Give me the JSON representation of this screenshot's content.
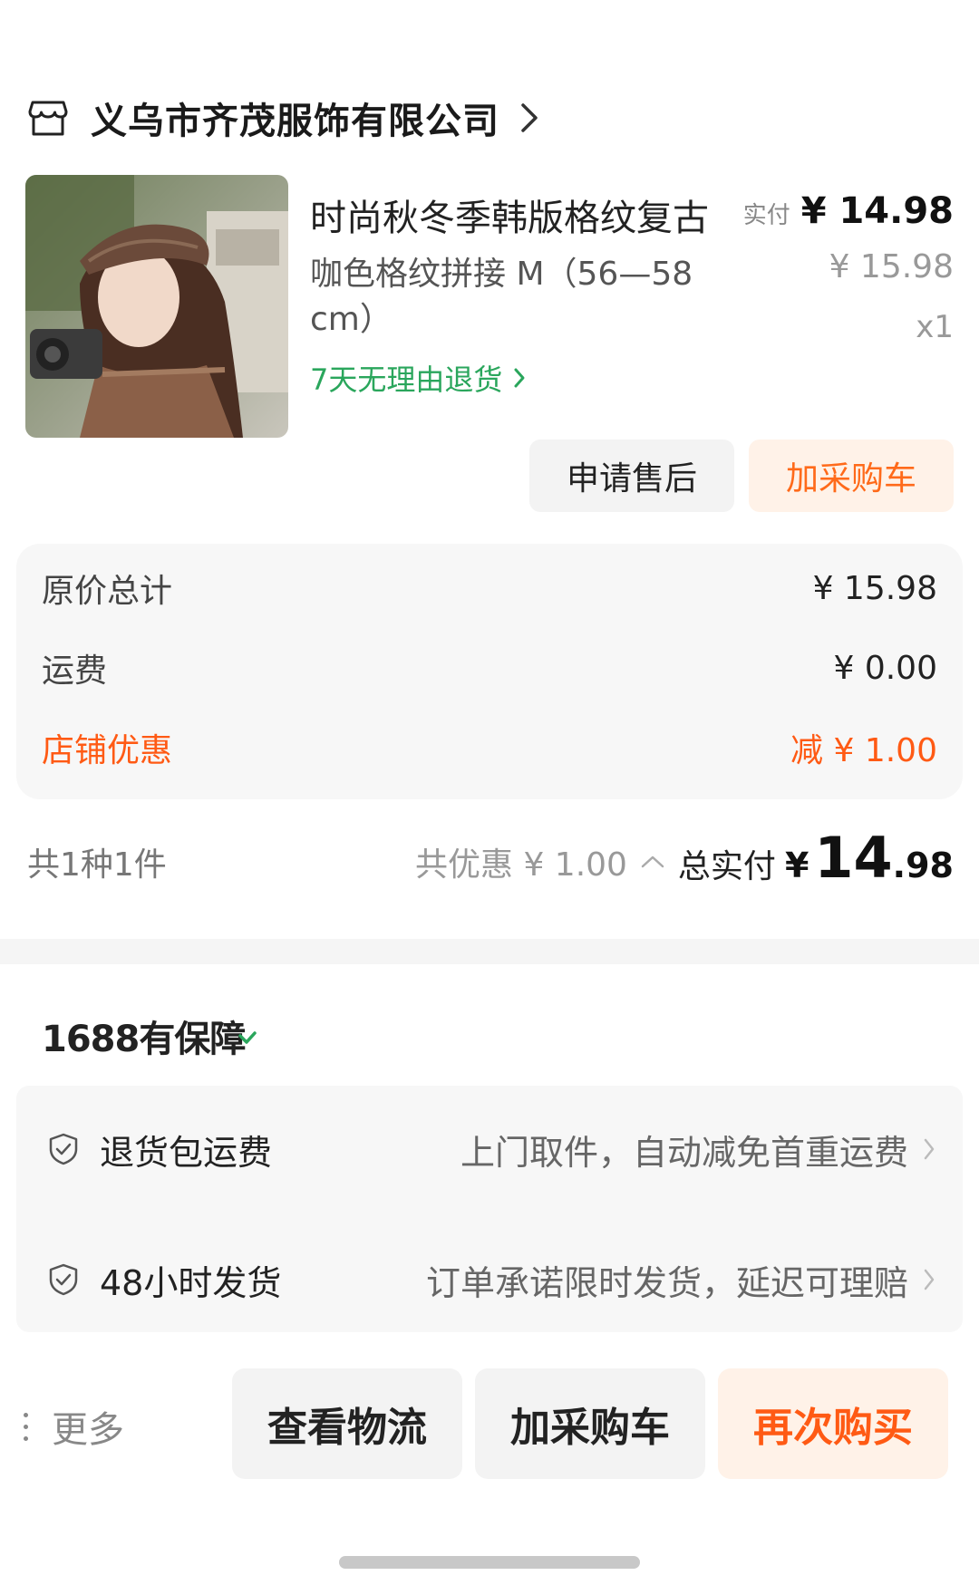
{
  "store": {
    "name": "义乌市齐茂服饰有限公司",
    "icon": "store-icon"
  },
  "product": {
    "title": "时尚秋冬季韩版格纹复古",
    "spec": "咖色格纹拼接 M（56—58 cm）",
    "return_policy": "7天无理由退货",
    "paid_label": "实付",
    "paid_price": "¥ 14.98",
    "original_price": "¥ 15.98",
    "quantity": "x1"
  },
  "actions": {
    "after_sale": "申请售后",
    "add_cart": "加采购车"
  },
  "summary": {
    "original_total_label": "原价总计",
    "original_total_value": "¥ 15.98",
    "shipping_label": "运费",
    "shipping_value": "¥ 0.00",
    "discount_label": "店铺优惠",
    "discount_value": "减 ¥ 1.00"
  },
  "totals": {
    "count": "共1种1件",
    "saved": "共优惠 ¥ 1.00",
    "total_label": "总实付",
    "currency": "¥",
    "total_int": "14",
    "total_dec": ".98"
  },
  "guarantee": {
    "title": "1688有保障",
    "items": [
      {
        "name": "退货包运费",
        "desc": "上门取件，自动减免首重运费"
      },
      {
        "name": "48小时发货",
        "desc": "订单承诺限时发货，延迟可理赔"
      }
    ]
  },
  "bottom_bar": {
    "more": "更多",
    "logistics": "查看物流",
    "add_cart": "加采购车",
    "rebuy": "再次购买"
  },
  "colors": {
    "accent": "#ff5a14",
    "accent_bg": "#fff2e8",
    "green": "#2aa65c"
  }
}
